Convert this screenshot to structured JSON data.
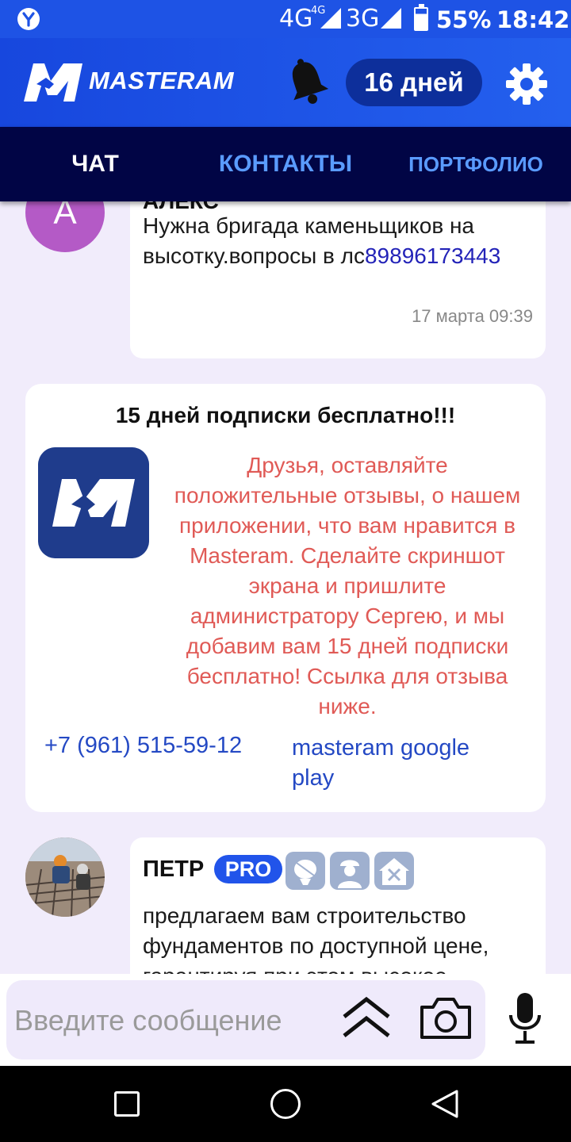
{
  "status_bar": {
    "network_4g": "4G",
    "network_4g_small": "4G",
    "network_3g": "3G",
    "battery": "55%",
    "time": "18:42"
  },
  "header": {
    "logo_text": "MASTERAM",
    "days_badge": "16 дней",
    "icons": [
      "logo-mark",
      "bell-icon",
      "gear-icon"
    ]
  },
  "tabs": [
    {
      "label": "ЧАТ",
      "active": true
    },
    {
      "label": "КОНТАКТЫ",
      "active": false
    },
    {
      "label": "ПОРТФОЛИО",
      "active": false
    }
  ],
  "messages": [
    {
      "avatar_letter": "А",
      "author": "АЛЕКС",
      "text": "Нужна бригада каменьщиков на высотку.вопросы в лс",
      "phone": "89896173443",
      "time": "17 марта 09:39"
    },
    {
      "author": "ПЕТР",
      "badge": "PRO",
      "text": "предлагаем вам строительство фундаментов по доступной цене, гарантируя при этом высокое"
    }
  ],
  "promo": {
    "title": "15 дней подписки бесплатно!!!",
    "text": "Друзья, оставляйте положительные отзывы, о нашем приложении, что вам нравится в Masteram. Сделайте скриншот экрана и пришлите администратору Сергею, и мы добавим вам 15 дней подписки бесплатно! Ссылка для отзыва ниже.",
    "phone": "+7 (961) 515-59-12",
    "link": "masteram google play"
  },
  "composer": {
    "placeholder": "Введите сообщение"
  },
  "colors": {
    "header_blue": "#1e53e5",
    "tabs_bg": "#010545",
    "promo_text": "#e05a56",
    "link_blue": "#2449c4",
    "pro_badge": "#2154ea"
  }
}
